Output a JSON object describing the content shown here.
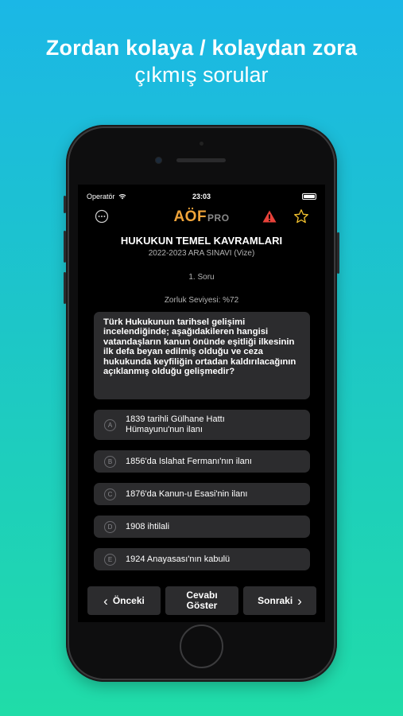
{
  "headline": {
    "line1": "Zordan kolaya / kolaydan zora",
    "line2": "çıkmış sorular"
  },
  "status_bar": {
    "carrier": "Operatör",
    "time": "23:03"
  },
  "app": {
    "logo_main": "AÖF",
    "logo_suffix": "PRO",
    "course_title": "HUKUKUN TEMEL KAVRAMLARI",
    "exam_subtitle": "2022-2023 ARA SINAVI (Vize)",
    "question_number": "1. Soru",
    "difficulty": "Zorluk Seviyesi: %72",
    "question_text": "Türk Hukukunun tarihsel gelişimi incelendiğinde; aşağıdakileren hangisi vatandaşların kanun önünde eşitliği ilkesinin ilk defa beyan edilmiş olduğu ve ceza hukukunda keyfiliğin ortadan kaldırılacağının açıklanmış olduğu gelişmedir?",
    "options": [
      {
        "letter": "A",
        "text": "1839 tarihli Gülhane Hattı Hümayunu'nun ilanı"
      },
      {
        "letter": "B",
        "text": "1856'da Islahat Fermanı'nın ilanı"
      },
      {
        "letter": "C",
        "text": "1876'da Kanun-u Esasi'nin ilanı"
      },
      {
        "letter": "D",
        "text": "1908 ihtilali"
      },
      {
        "letter": "E",
        "text": "1924 Anayasası'nın kabulü"
      }
    ],
    "buttons": {
      "prev": "Önceki",
      "show_answer": "Cevabı Göster",
      "next": "Sonraki"
    }
  },
  "colors": {
    "logo_accent": "#f0a43a",
    "warning": "#e8423a",
    "star": "#f2c12e",
    "card_bg": "#2c2c2e"
  },
  "icons": {
    "more": "more-icon",
    "warning": "warning-icon",
    "star": "star-icon",
    "wifi": "wifi-icon",
    "battery": "battery-icon",
    "prev": "chevron-left-icon",
    "next": "chevron-right-icon"
  }
}
